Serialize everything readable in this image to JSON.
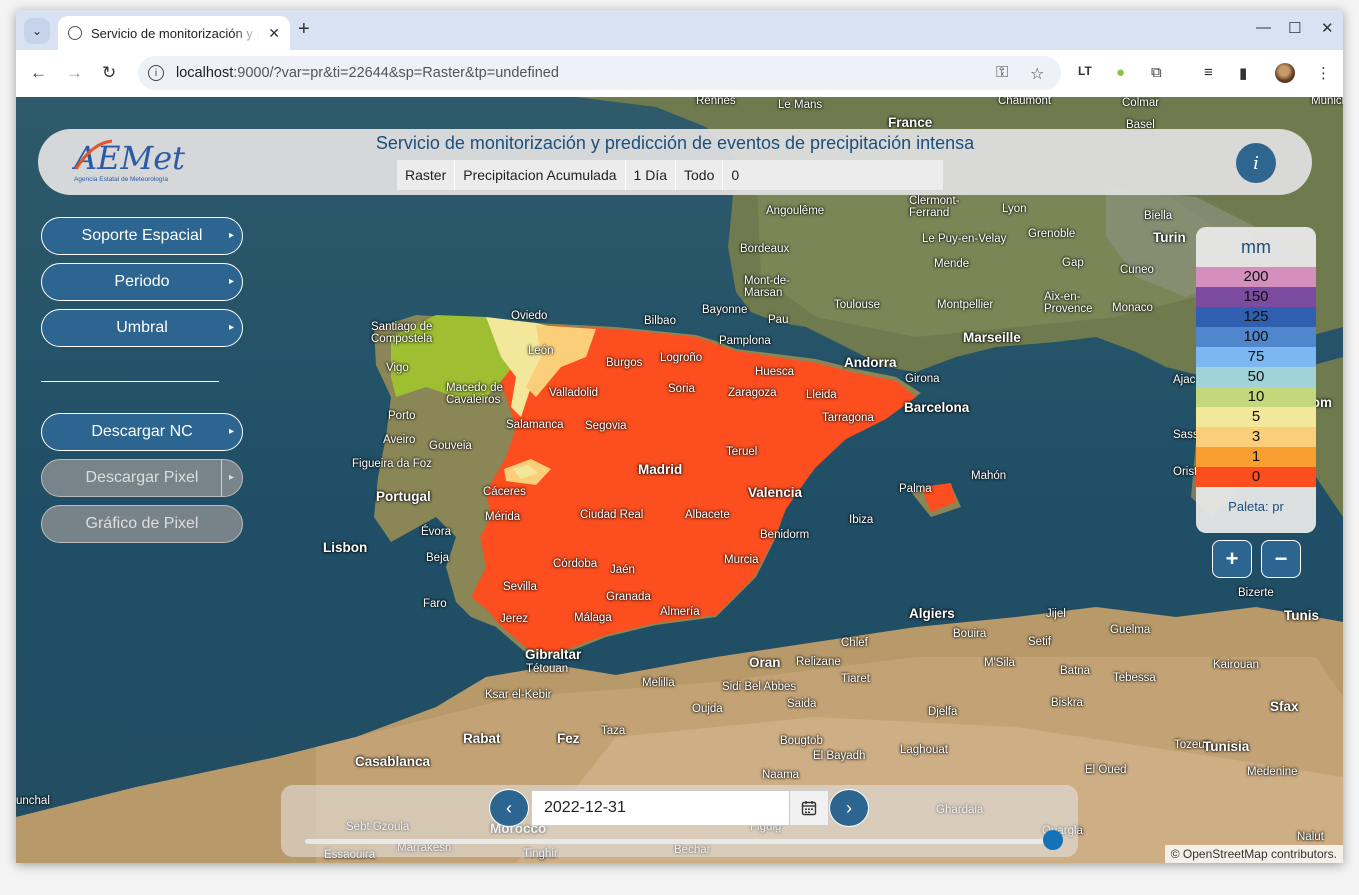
{
  "browser": {
    "tab_title": "Servicio de monitorización y predicción de eventos de precipitación intensa",
    "url_host": "localhost",
    "url_rest": ":9000/?var=pr&ti=22644&sp=Raster&tp=undefined"
  },
  "header": {
    "logo_text": "AEMet",
    "logo_subtitle": "Agencia Estatal de Meteorología",
    "title": "Servicio de monitorización y predicción de eventos de precipitación intensa",
    "breadcrumbs": [
      "Raster",
      "Precipitacion Acumulada",
      "1 Día",
      "Todo",
      "0"
    ]
  },
  "menu": {
    "soporte": "Soporte Espacial",
    "periodo": "Periodo",
    "umbral": "Umbral",
    "descargar_nc": "Descargar NC",
    "descargar_pixel": "Descargar Pixel",
    "grafico_pixel": "Gráfico de Pixel"
  },
  "legend": {
    "unit": "mm",
    "items": [
      {
        "value": "200",
        "color": "#d48fbf"
      },
      {
        "value": "150",
        "color": "#7a4b9e"
      },
      {
        "value": "125",
        "color": "#2f5fae"
      },
      {
        "value": "100",
        "color": "#4f86cc"
      },
      {
        "value": "75",
        "color": "#7db7f1"
      },
      {
        "value": "50",
        "color": "#9fd3d9"
      },
      {
        "value": "10",
        "color": "#c4d77a"
      },
      {
        "value": "5",
        "color": "#f2e79a"
      },
      {
        "value": "3",
        "color": "#fbcf7a"
      },
      {
        "value": "1",
        "color": "#f99f32"
      },
      {
        "value": "0",
        "color": "#fc4e1f"
      }
    ],
    "palette": "Paleta: pr"
  },
  "zoom": {
    "in": "+",
    "out": "−"
  },
  "date": {
    "value": "2022-12-31",
    "prev": "‹",
    "next": "›",
    "slider_fraction": 1.0
  },
  "attribution": "© OpenStreetMap contributors.",
  "places": [
    "Rennes",
    "Le Mans",
    "France",
    "Chaumont",
    "Colmar",
    "Munich",
    "Basel",
    "Angoulême",
    "Clermont-Ferrand",
    "Lyon",
    "Biella",
    "Turin",
    "Bordeaux",
    "Le Puy-en-Velay",
    "Grenoble",
    "Mende",
    "Gap",
    "Cuneo",
    "Mont-de-Marsan",
    "Toulouse",
    "Montpellier",
    "Aix-en-Provence",
    "Monaco",
    "Bayonne",
    "Pau",
    "Marseille",
    "Santiago de Compostela",
    "Oviedo",
    "Bilbao",
    "Pamplona",
    "León",
    "Burgos",
    "Logroño",
    "Andorra",
    "Vigo",
    "Macedo de Cavaleiros",
    "Valladolid",
    "Soria",
    "Huesca",
    "Girona",
    "Zaragoza",
    "Lleida",
    "Barcelona",
    "Porto",
    "Salamanca",
    "Segovia",
    "Tarragona",
    "Aveiro",
    "Gouveia",
    "Figueira da Foz",
    "Madrid",
    "Teruel",
    "Portugal",
    "Cáceres",
    "Valencia",
    "Mahón",
    "Palma",
    "Mérida",
    "Ciudad Real",
    "Albacete",
    "Ibiza",
    "Évora",
    "Benidorm",
    "Lisbon",
    "Beja",
    "Córdoba",
    "Jaén",
    "Murcia",
    "Sevilla",
    "Granada",
    "Faro",
    "Almería",
    "Jerez",
    "Málaga",
    "Algiers",
    "Jijel",
    "Tunis",
    "Bizerte",
    "Bouira",
    "Setif",
    "Guelma",
    "Gibraltar",
    "Chlef",
    "Tétouan",
    "Oran",
    "Relizane",
    "M'Sila",
    "Batna",
    "Kairouan",
    "Tiaret",
    "Melilla",
    "Tebessa",
    "Ksar el-Kebir",
    "Sidi Bel Abbes",
    "Oujda",
    "Saida",
    "Biskra",
    "Sfax",
    "Djelfa",
    "Rabat",
    "Fez",
    "Taza",
    "Tozeur",
    "Tunisia",
    "Bougtob",
    "Laghouat",
    "Casablanca",
    "El Bayadh",
    "Naama",
    "El Oued",
    "Medenine",
    "Ghardaia",
    "Sebt Gzoula",
    "Morocco",
    "Marrakesh",
    "Figuig",
    "Essaouira",
    "Tinghir",
    "Bechar",
    "Nalut",
    "Ouargla",
    "Bizerte",
    "Sassari",
    "Oristano",
    "Roma",
    "Aja",
    "Ajaccio"
  ]
}
